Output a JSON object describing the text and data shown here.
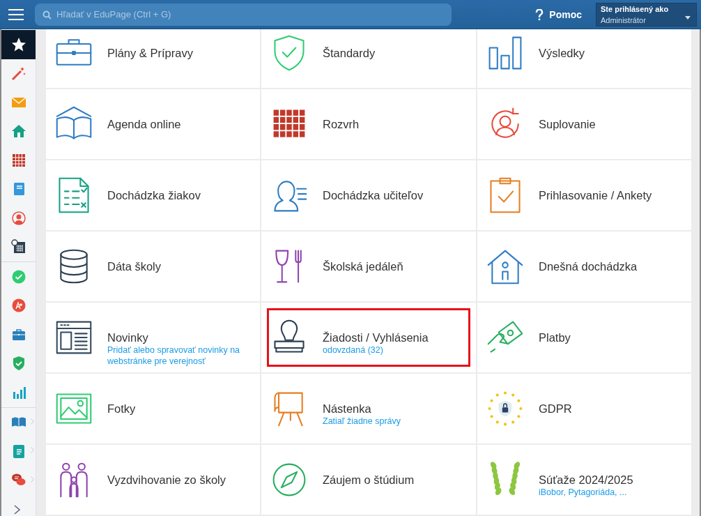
{
  "header": {
    "search": {
      "placeholder": "Hľadať v EduPage (Ctrl + G)"
    },
    "help": {
      "label": "Pomoc"
    },
    "user": {
      "caption": "Ste prihlásený ako",
      "role": "Administrátor"
    }
  },
  "sidebar": {
    "items": [
      {
        "selected": true,
        "submenu": false
      },
      {
        "selected": false,
        "submenu": false
      },
      {
        "selected": false,
        "submenu": false
      },
      {
        "selected": false,
        "submenu": false
      },
      {
        "selected": false,
        "submenu": false
      },
      {
        "selected": false,
        "submenu": false
      },
      {
        "selected": false,
        "submenu": false
      },
      {
        "selected": false,
        "submenu": false
      },
      {
        "selected": false,
        "submenu": false
      },
      {
        "selected": false,
        "submenu": false
      },
      {
        "selected": false,
        "submenu": false
      },
      {
        "selected": false,
        "submenu": false
      },
      {
        "selected": false,
        "submenu": false
      },
      {
        "selected": false,
        "submenu": true
      },
      {
        "selected": false,
        "submenu": true
      },
      {
        "selected": false,
        "submenu": true
      }
    ]
  },
  "tiles": [
    {
      "title": "Plány & Prípravy",
      "highlighted": false
    },
    {
      "title": "Štandardy",
      "highlighted": false
    },
    {
      "title": "Výsledky",
      "highlighted": false
    },
    {
      "title": "Agenda online",
      "highlighted": false
    },
    {
      "title": "Rozvrh",
      "highlighted": false
    },
    {
      "title": "Suplovanie",
      "highlighted": false
    },
    {
      "title": "Dochádzka žiakov",
      "highlighted": false
    },
    {
      "title": "Dochádzka učiteľov",
      "highlighted": false
    },
    {
      "title": "Prihlasovanie / Ankety",
      "highlighted": false
    },
    {
      "title": "Dáta školy",
      "highlighted": false
    },
    {
      "title": "Školská jedáleň",
      "highlighted": false
    },
    {
      "title": "Dnešná dochádzka",
      "highlighted": false
    },
    {
      "title": "Novinky",
      "subtitle": "Pridať alebo spravovať novinky na webstránke pre verejnosť",
      "highlighted": false
    },
    {
      "title": "Žiadosti / Vyhlásenia",
      "subtitle": "odovzdaná (32)",
      "highlighted": true
    },
    {
      "title": "Platby",
      "highlighted": false
    },
    {
      "title": "Fotky",
      "highlighted": false
    },
    {
      "title": "Nástenka",
      "subtitle": "Zatiaľ žiadne správy",
      "highlighted": false
    },
    {
      "title": "GDPR",
      "highlighted": false
    },
    {
      "title": "Vyzdvihovanie zo školy",
      "highlighted": false
    },
    {
      "title": "Záujem o štúdium",
      "highlighted": false
    },
    {
      "title": "Súťaže 2024/2025",
      "subtitle": "iBobor, Pytagoriáda, ...",
      "highlighted": false
    }
  ]
}
